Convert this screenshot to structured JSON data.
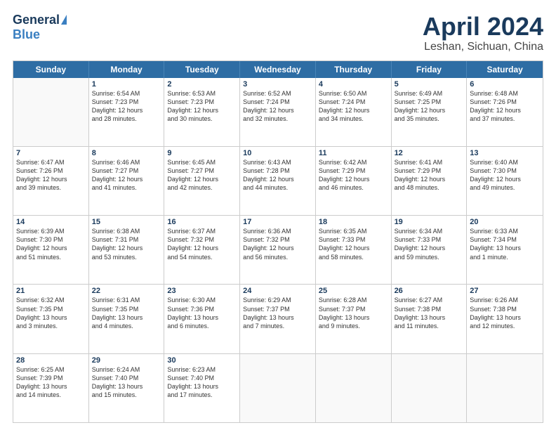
{
  "header": {
    "logo_general": "General",
    "logo_blue": "Blue",
    "title": "April 2024",
    "location": "Leshan, Sichuan, China"
  },
  "weekdays": [
    "Sunday",
    "Monday",
    "Tuesday",
    "Wednesday",
    "Thursday",
    "Friday",
    "Saturday"
  ],
  "rows": [
    [
      {
        "day": "",
        "detail": ""
      },
      {
        "day": "1",
        "detail": "Sunrise: 6:54 AM\nSunset: 7:23 PM\nDaylight: 12 hours\nand 28 minutes."
      },
      {
        "day": "2",
        "detail": "Sunrise: 6:53 AM\nSunset: 7:23 PM\nDaylight: 12 hours\nand 30 minutes."
      },
      {
        "day": "3",
        "detail": "Sunrise: 6:52 AM\nSunset: 7:24 PM\nDaylight: 12 hours\nand 32 minutes."
      },
      {
        "day": "4",
        "detail": "Sunrise: 6:50 AM\nSunset: 7:24 PM\nDaylight: 12 hours\nand 34 minutes."
      },
      {
        "day": "5",
        "detail": "Sunrise: 6:49 AM\nSunset: 7:25 PM\nDaylight: 12 hours\nand 35 minutes."
      },
      {
        "day": "6",
        "detail": "Sunrise: 6:48 AM\nSunset: 7:26 PM\nDaylight: 12 hours\nand 37 minutes."
      }
    ],
    [
      {
        "day": "7",
        "detail": "Sunrise: 6:47 AM\nSunset: 7:26 PM\nDaylight: 12 hours\nand 39 minutes."
      },
      {
        "day": "8",
        "detail": "Sunrise: 6:46 AM\nSunset: 7:27 PM\nDaylight: 12 hours\nand 41 minutes."
      },
      {
        "day": "9",
        "detail": "Sunrise: 6:45 AM\nSunset: 7:27 PM\nDaylight: 12 hours\nand 42 minutes."
      },
      {
        "day": "10",
        "detail": "Sunrise: 6:43 AM\nSunset: 7:28 PM\nDaylight: 12 hours\nand 44 minutes."
      },
      {
        "day": "11",
        "detail": "Sunrise: 6:42 AM\nSunset: 7:29 PM\nDaylight: 12 hours\nand 46 minutes."
      },
      {
        "day": "12",
        "detail": "Sunrise: 6:41 AM\nSunset: 7:29 PM\nDaylight: 12 hours\nand 48 minutes."
      },
      {
        "day": "13",
        "detail": "Sunrise: 6:40 AM\nSunset: 7:30 PM\nDaylight: 12 hours\nand 49 minutes."
      }
    ],
    [
      {
        "day": "14",
        "detail": "Sunrise: 6:39 AM\nSunset: 7:30 PM\nDaylight: 12 hours\nand 51 minutes."
      },
      {
        "day": "15",
        "detail": "Sunrise: 6:38 AM\nSunset: 7:31 PM\nDaylight: 12 hours\nand 53 minutes."
      },
      {
        "day": "16",
        "detail": "Sunrise: 6:37 AM\nSunset: 7:32 PM\nDaylight: 12 hours\nand 54 minutes."
      },
      {
        "day": "17",
        "detail": "Sunrise: 6:36 AM\nSunset: 7:32 PM\nDaylight: 12 hours\nand 56 minutes."
      },
      {
        "day": "18",
        "detail": "Sunrise: 6:35 AM\nSunset: 7:33 PM\nDaylight: 12 hours\nand 58 minutes."
      },
      {
        "day": "19",
        "detail": "Sunrise: 6:34 AM\nSunset: 7:33 PM\nDaylight: 12 hours\nand 59 minutes."
      },
      {
        "day": "20",
        "detail": "Sunrise: 6:33 AM\nSunset: 7:34 PM\nDaylight: 13 hours\nand 1 minute."
      }
    ],
    [
      {
        "day": "21",
        "detail": "Sunrise: 6:32 AM\nSunset: 7:35 PM\nDaylight: 13 hours\nand 3 minutes."
      },
      {
        "day": "22",
        "detail": "Sunrise: 6:31 AM\nSunset: 7:35 PM\nDaylight: 13 hours\nand 4 minutes."
      },
      {
        "day": "23",
        "detail": "Sunrise: 6:30 AM\nSunset: 7:36 PM\nDaylight: 13 hours\nand 6 minutes."
      },
      {
        "day": "24",
        "detail": "Sunrise: 6:29 AM\nSunset: 7:37 PM\nDaylight: 13 hours\nand 7 minutes."
      },
      {
        "day": "25",
        "detail": "Sunrise: 6:28 AM\nSunset: 7:37 PM\nDaylight: 13 hours\nand 9 minutes."
      },
      {
        "day": "26",
        "detail": "Sunrise: 6:27 AM\nSunset: 7:38 PM\nDaylight: 13 hours\nand 11 minutes."
      },
      {
        "day": "27",
        "detail": "Sunrise: 6:26 AM\nSunset: 7:38 PM\nDaylight: 13 hours\nand 12 minutes."
      }
    ],
    [
      {
        "day": "28",
        "detail": "Sunrise: 6:25 AM\nSunset: 7:39 PM\nDaylight: 13 hours\nand 14 minutes."
      },
      {
        "day": "29",
        "detail": "Sunrise: 6:24 AM\nSunset: 7:40 PM\nDaylight: 13 hours\nand 15 minutes."
      },
      {
        "day": "30",
        "detail": "Sunrise: 6:23 AM\nSunset: 7:40 PM\nDaylight: 13 hours\nand 17 minutes."
      },
      {
        "day": "",
        "detail": ""
      },
      {
        "day": "",
        "detail": ""
      },
      {
        "day": "",
        "detail": ""
      },
      {
        "day": "",
        "detail": ""
      }
    ]
  ]
}
